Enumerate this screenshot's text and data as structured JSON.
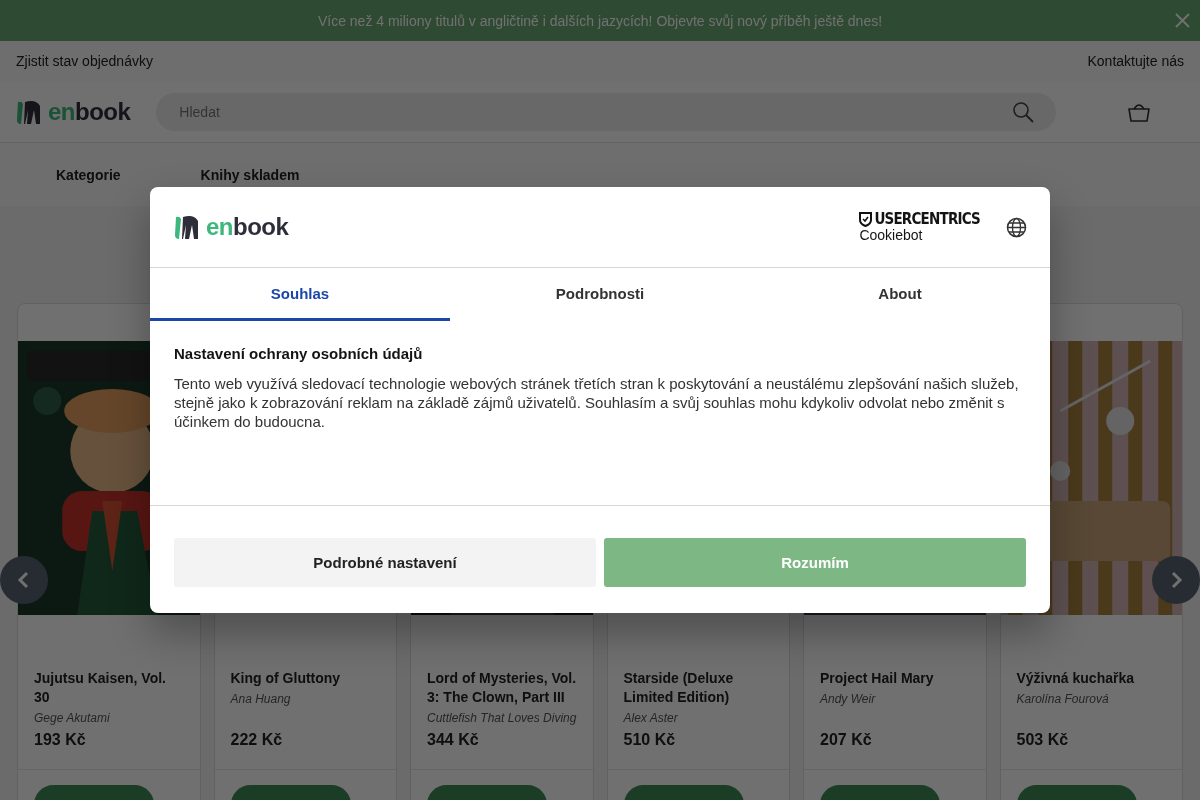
{
  "banner": {
    "text": "Více než 4 miliony titulů v angličtině i dalších jazycích! Objevte svůj nový příběh ještě dnes!"
  },
  "top_links": {
    "left": "Zjistit stav objednávky",
    "right": "Kontaktujte nás"
  },
  "header": {
    "logo_en": "en",
    "logo_book": "book",
    "search": {
      "placeholder": "Hledat"
    }
  },
  "nav": [
    "Kategorie",
    "Knihy skladem"
  ],
  "books": [
    {
      "title": "Jujutsu Kaisen, Vol. 30",
      "author": "Gege Akutami",
      "price": "193 Kč"
    },
    {
      "title": "King of Gluttony",
      "author": "Ana Huang",
      "price": "222 Kč"
    },
    {
      "title": "Lord of Mysteries, Vol. 3: The Clown, Part III",
      "author": "Cuttlefish That Loves Diving",
      "price": "344 Kč"
    },
    {
      "title": "Starside (Deluxe Limited Edition)",
      "author": "Alex Aster",
      "price": "510 Kč"
    },
    {
      "title": "Project Hail Mary",
      "author": "Andy Weir",
      "price": "207 Kč"
    },
    {
      "title": "Výživná kuchařka",
      "author": "Karolína Fourová",
      "price": "503 Kč"
    }
  ],
  "consent": {
    "logo_en": "en",
    "logo_book": "book",
    "provider": "USERCENTRICS",
    "provider_sub": "Cookiebot",
    "tabs": [
      {
        "label": "Souhlas",
        "selected": true
      },
      {
        "label": "Podrobnosti",
        "selected": false
      },
      {
        "label": "About",
        "selected": false
      }
    ],
    "heading": "Nastavení ochrany osobních údajů",
    "text": "Tento web využívá sledovací technologie webových stránek třetích stran k poskytování a neustálému zlepšování našich služeb, stejně jako k zobrazování reklam na základě zájmů uživatelů. Souhlasím a svůj souhlas mohu kdykoliv odvolat nebo změnit s účinkem do budoucna.",
    "buttons": [
      {
        "label": "Podrobné nastavení",
        "kind": "secondary"
      },
      {
        "label": "Rozumím",
        "kind": "primary"
      }
    ]
  }
}
